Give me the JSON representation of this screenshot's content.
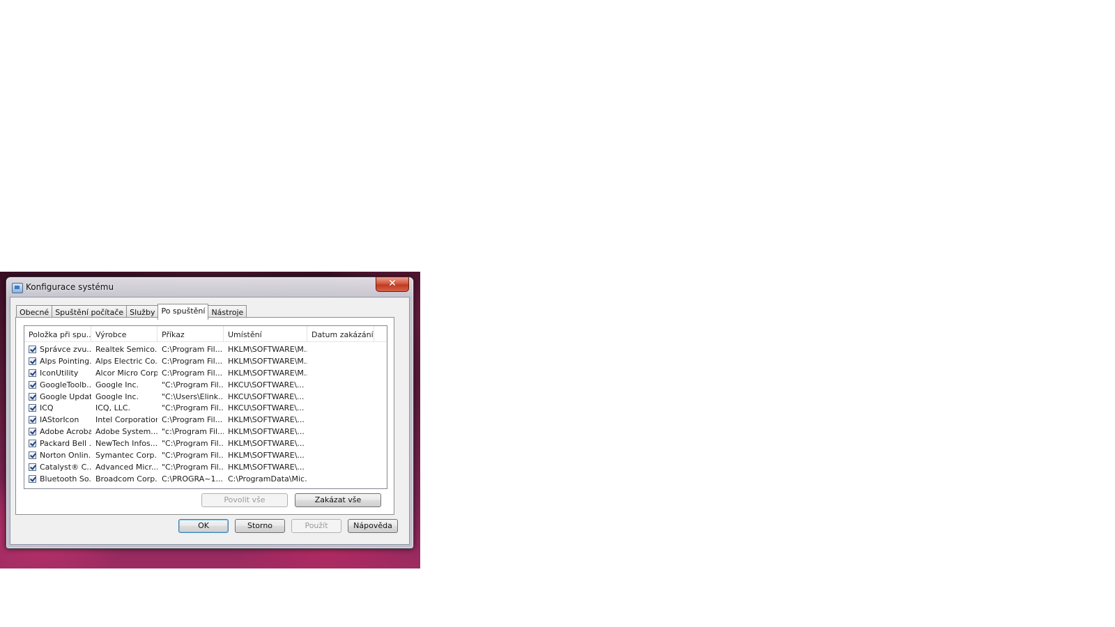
{
  "window": {
    "title": "Konfigurace systému",
    "close_glyph": "✕"
  },
  "tabs": [
    {
      "label": "Obecné",
      "active": false
    },
    {
      "label": "Spuštění počítače",
      "active": false
    },
    {
      "label": "Služby",
      "active": false
    },
    {
      "label": "Po spuštění",
      "active": true
    },
    {
      "label": "Nástroje",
      "active": false
    }
  ],
  "startup": {
    "columns": [
      "Položka při spu...",
      "Výrobce",
      "Příkaz",
      "Umístění",
      "Datum zakázání"
    ],
    "rows": [
      {
        "item": "Správce zvu...",
        "vendor": "Realtek Semico...",
        "command": "C:\\Program Fil...",
        "location": "HKLM\\SOFTWARE\\M...",
        "date": "",
        "checked": true
      },
      {
        "item": "Alps Pointing...",
        "vendor": "Alps Electric Co...",
        "command": "C:\\Program Fil...",
        "location": "HKLM\\SOFTWARE\\M...",
        "date": "",
        "checked": true
      },
      {
        "item": "IconUtility",
        "vendor": "Alcor Micro Corp.",
        "command": "C:\\Program Fil...",
        "location": "HKLM\\SOFTWARE\\M...",
        "date": "",
        "checked": true
      },
      {
        "item": "GoogleToolb...",
        "vendor": "Google Inc.",
        "command": "\"C:\\Program Fil...",
        "location": "HKCU\\SOFTWARE\\...",
        "date": "",
        "checked": true
      },
      {
        "item": "Google Update",
        "vendor": "Google Inc.",
        "command": "\"C:\\Users\\Elink...",
        "location": "HKCU\\SOFTWARE\\...",
        "date": "",
        "checked": true
      },
      {
        "item": "ICQ",
        "vendor": "ICQ, LLC.",
        "command": "\"C:\\Program Fil...",
        "location": "HKCU\\SOFTWARE\\...",
        "date": "",
        "checked": true
      },
      {
        "item": "IAStorIcon",
        "vendor": "Intel Corporation",
        "command": "C:\\Program Fil...",
        "location": "HKLM\\SOFTWARE\\...",
        "date": "",
        "checked": true
      },
      {
        "item": "Adobe Acrobat",
        "vendor": "Adobe System...",
        "command": "\"c:\\Program Fil...",
        "location": "HKLM\\SOFTWARE\\...",
        "date": "",
        "checked": true
      },
      {
        "item": "Packard Bell ...",
        "vendor": "NewTech Infos...",
        "command": "\"C:\\Program Fil...",
        "location": "HKLM\\SOFTWARE\\...",
        "date": "",
        "checked": true
      },
      {
        "item": "Norton Onlin...",
        "vendor": "Symantec Corp...",
        "command": "\"C:\\Program Fil...",
        "location": "HKLM\\SOFTWARE\\...",
        "date": "",
        "checked": true
      },
      {
        "item": "Catalyst® C...",
        "vendor": "Advanced Micr...",
        "command": "\"C:\\Program Fil...",
        "location": "HKLM\\SOFTWARE\\...",
        "date": "",
        "checked": true
      },
      {
        "item": "Bluetooth So...",
        "vendor": "Broadcom Corp...",
        "command": "C:\\PROGRA~1...",
        "location": "C:\\ProgramData\\Mic...",
        "date": "",
        "checked": true
      }
    ],
    "enable_all": "Povolit vše",
    "disable_all": "Zakázat vše"
  },
  "buttons": {
    "ok": "OK",
    "cancel": "Storno",
    "apply": "Použít",
    "help": "Nápověda"
  }
}
